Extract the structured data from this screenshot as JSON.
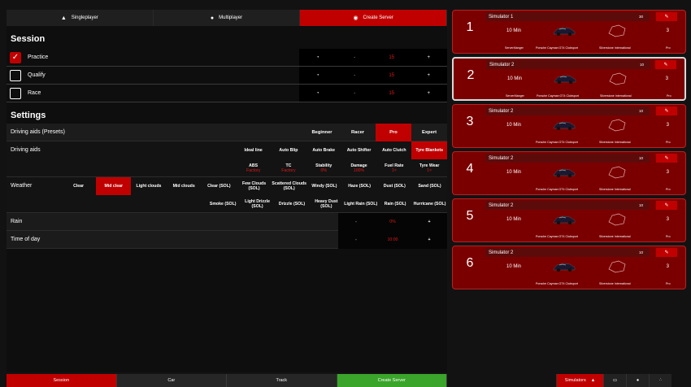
{
  "top_tabs": [
    {
      "label": "Singleplayer",
      "icon": "person-icon"
    },
    {
      "label": "Multiplayer",
      "icon": "people-icon"
    },
    {
      "label": "Create Server",
      "icon": "server-icon",
      "active": true
    }
  ],
  "session": {
    "title": "Session",
    "rows": [
      {
        "name": "Practice",
        "checked": true,
        "dash": "-",
        "value": "15",
        "plus": "+"
      },
      {
        "name": "Qualify",
        "checked": false,
        "dash": "-",
        "value": "15",
        "plus": "+"
      },
      {
        "name": "Race",
        "checked": false,
        "dash": "-",
        "value": "15",
        "plus": "+"
      }
    ]
  },
  "settings": {
    "title": "Settings",
    "presets_label": "Driving aids (Presets)",
    "presets": [
      "Beginner",
      "Racer",
      "Pro",
      "Expert"
    ],
    "presets_selected": "Pro",
    "aids_label": "Driving aids",
    "aids_row1": [
      "Ideal line",
      "Auto Blip",
      "Auto Brake",
      "Auto Shifter",
      "Auto Clutch",
      "Tyre Blankets"
    ],
    "aids_row2": [
      {
        "label": "ABS",
        "value": "Factory"
      },
      {
        "label": "TC",
        "value": "Factory"
      },
      {
        "label": "Stability",
        "value": "0%"
      },
      {
        "label": "Damage",
        "value": "100%"
      },
      {
        "label": "Fuel Rate",
        "value": "1×"
      },
      {
        "label": "Tyre Wear",
        "value": "1×"
      }
    ],
    "weather_label": "Weather",
    "weather_row1": [
      "Clear",
      "Mid clear",
      "Light clouds",
      "Mid clouds",
      "Clear (SOL)",
      "Few Clouds (SOL)",
      "Scattered Clouds (SOL)",
      "Windy (SOL)",
      "Haze (SOL)",
      "Dust (SOL)",
      "Sand (SOL)"
    ],
    "weather_selected": "Mid clear",
    "weather_row2": [
      "Smoke (SOL)",
      "Light Drizzle (SOL)",
      "Drizzle (SOL)",
      "Heavy Dust (SOL)",
      "Light Rain (SOL)",
      "Rain (SOL)",
      "Hurricane (SOL)"
    ],
    "rain_label": "Rain",
    "rain_value": "0%",
    "time_label": "Time of day",
    "time_value": "10:00",
    "dash": "-",
    "plus": "+"
  },
  "simulators": [
    {
      "number": "1",
      "name": "Simulator 1",
      "version": "30",
      "duration": "10 Min",
      "count": "3",
      "manager": "ServerManger",
      "car": "Porsche Cayman GT4 Clubsport",
      "track": "Silverstone International",
      "level": "Pro"
    },
    {
      "number": "2",
      "name": "Simulator 2",
      "version": "10",
      "duration": "10 Min",
      "count": "3",
      "manager": "ServerManger",
      "car": "Porsche Cayman GT4 Clubsport",
      "track": "Silverstone International",
      "level": "Pro"
    },
    {
      "number": "3",
      "name": "Simulator 2",
      "version": "10",
      "duration": "10 Min",
      "count": "3",
      "manager": "",
      "car": "Porsche Cayman GT4 Clubsport",
      "track": "Silverstone International",
      "level": "Pro"
    },
    {
      "number": "4",
      "name": "Simulator 2",
      "version": "10",
      "duration": "10 Min",
      "count": "3",
      "manager": "",
      "car": "Porsche Cayman GT4 Clubsport",
      "track": "Silverstone International",
      "level": "Pro"
    },
    {
      "number": "5",
      "name": "Simulator 2",
      "version": "10",
      "duration": "10 Min",
      "count": "3",
      "manager": "",
      "car": "Porsche Cayman GT4 Clubsport",
      "track": "Silverstone International",
      "level": "Pro"
    },
    {
      "number": "6",
      "name": "Simulator 2",
      "version": "10",
      "duration": "10 Min",
      "count": "3",
      "manager": "",
      "car": "Porsche Cayman GT4 Clubsport",
      "track": "Silverstone International",
      "level": "Pro"
    }
  ],
  "bottom_tabs": [
    {
      "label": "Session",
      "style": "red"
    },
    {
      "label": "Car",
      "style": "dark"
    },
    {
      "label": "Track",
      "style": "dark"
    },
    {
      "label": "Create Server",
      "style": "green"
    }
  ],
  "bottom_right": {
    "simulators_label": "Simulators",
    "icons": [
      "toggle-icon",
      "monitor-icon",
      "user-icon",
      "network-icon"
    ]
  },
  "colors": {
    "accent": "#c00000",
    "card": "#7a0000",
    "green": "#3aa52a"
  }
}
